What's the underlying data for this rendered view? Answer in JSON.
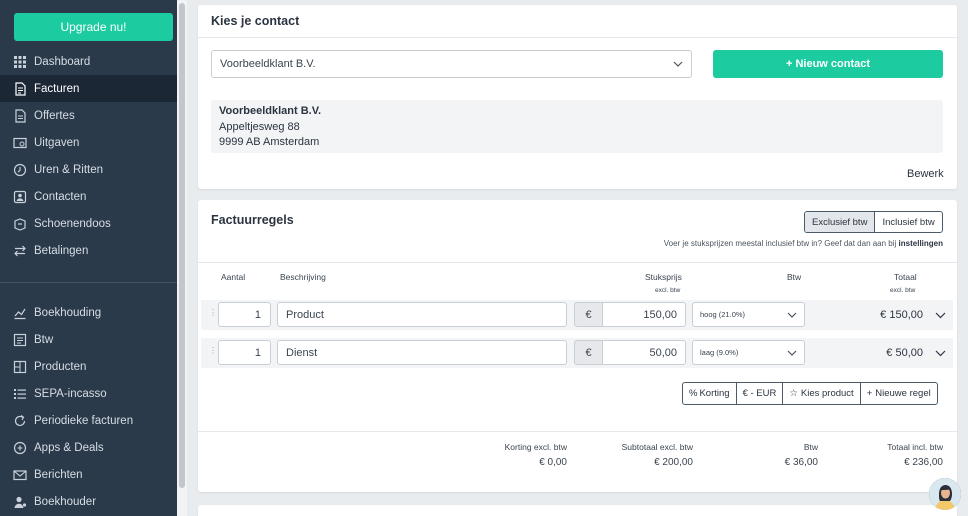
{
  "sidebar": {
    "upgrade_label": "Upgrade nu!",
    "items": [
      {
        "label": "Dashboard",
        "icon": "grid-icon"
      },
      {
        "label": "Facturen",
        "icon": "invoice-icon",
        "active": true
      },
      {
        "label": "Offertes",
        "icon": "quote-icon"
      },
      {
        "label": "Uitgaven",
        "icon": "expenses-icon"
      },
      {
        "label": "Uren & Ritten",
        "icon": "clock-icon"
      },
      {
        "label": "Contacten",
        "icon": "contact-icon"
      },
      {
        "label": "Schoenendoos",
        "icon": "box-icon"
      },
      {
        "label": "Betalingen",
        "icon": "transfer-icon"
      }
    ],
    "items2": [
      {
        "label": "Boekhouding",
        "icon": "chart-icon"
      },
      {
        "label": "Btw",
        "icon": "tax-icon"
      },
      {
        "label": "Producten",
        "icon": "product-icon"
      },
      {
        "label": "SEPA-incasso",
        "icon": "list-icon"
      },
      {
        "label": "Periodieke facturen",
        "icon": "refresh-icon"
      },
      {
        "label": "Apps & Deals",
        "icon": "apps-icon"
      },
      {
        "label": "Berichten",
        "icon": "mail-icon"
      },
      {
        "label": "Boekhouder",
        "icon": "person-icon"
      }
    ]
  },
  "contact": {
    "title": "Kies je contact",
    "selected": "Voorbeeldklant B.V.",
    "new_button": "+ Nieuw contact",
    "address_name": "Voorbeeldklant B.V.",
    "address_street": "Appeltjesweg 88",
    "address_city": "9999 AB Amsterdam",
    "edit_link": "Bewerk"
  },
  "lines": {
    "title": "Factuurregels",
    "toggle_excl": "Exclusief btw",
    "toggle_incl": "Inclusief btw",
    "hint_text": "Voer je stuksprijzen meestal inclusief btw in? Geef dat dan aan bij",
    "hint_link": "instellingen",
    "headers": {
      "aantal": "Aantal",
      "beschrijving": "Beschrijving",
      "stuksprijs": "Stuksprijs",
      "stuksprijs_sub": "excl. btw",
      "btw": "Btw",
      "totaal": "Totaal",
      "totaal_sub": "excl. btw"
    },
    "rows": [
      {
        "qty": "1",
        "desc": "Product",
        "currency": "€",
        "price": "150,00",
        "btw": "hoog (21.0%)",
        "total": "€ 150,00"
      },
      {
        "qty": "1",
        "desc": "Dienst",
        "currency": "€",
        "price": "50,00",
        "btw": "laag (9.0%)",
        "total": "€ 50,00"
      }
    ],
    "actions": {
      "korting": "Korting",
      "currency": "€ - EUR",
      "kies_product": "Kies product",
      "nieuwe_regel": "Nieuwe regel"
    },
    "summary": {
      "korting_label": "Korting excl. btw",
      "korting_value": "€ 0,00",
      "subtotaal_label": "Subtotaal excl. btw",
      "subtotaal_value": "€ 200,00",
      "btw_label": "Btw",
      "btw_value": "€ 36,00",
      "totaal_label": "Totaal incl. btw",
      "totaal_value": "€ 236,00"
    }
  },
  "colors": {
    "sidebar_bg": "#2b3a4a",
    "accent": "#1ccb9f"
  }
}
